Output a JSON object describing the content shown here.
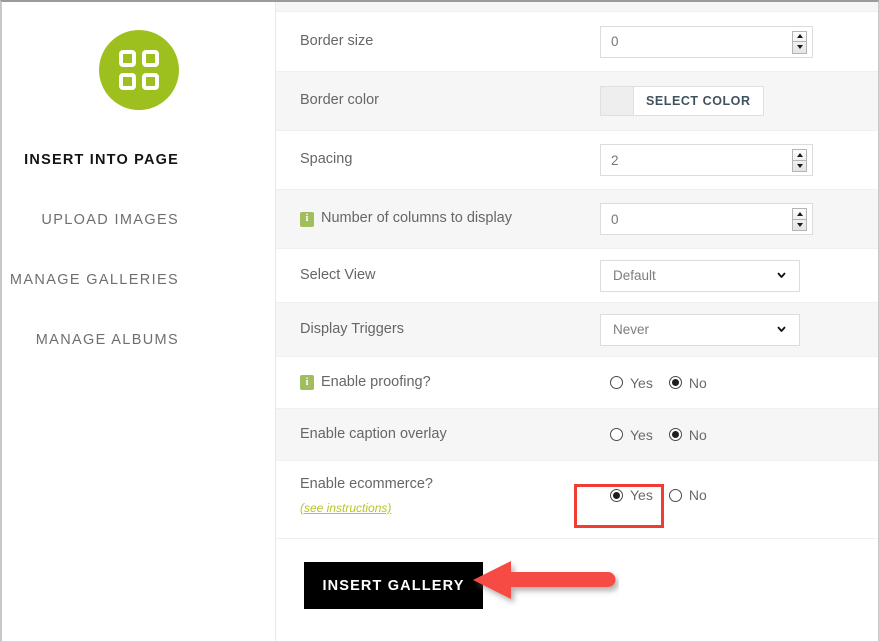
{
  "sidebar": {
    "logo_icon": "grid-squares-icon",
    "logo_color": "#9dc01f",
    "items": [
      {
        "label": "INSERT INTO PAGE",
        "active": true
      },
      {
        "label": "UPLOAD IMAGES",
        "active": false
      },
      {
        "label": "MANAGE GALLERIES",
        "active": false
      },
      {
        "label": "MANAGE ALBUMS",
        "active": false
      }
    ]
  },
  "form": {
    "rows": [
      {
        "label": "Border size",
        "type": "number",
        "value": "0",
        "info": false
      },
      {
        "label": "Border color",
        "type": "color",
        "value": "SELECT COLOR",
        "info": false
      },
      {
        "label": "Spacing",
        "type": "number",
        "value": "2",
        "info": false
      },
      {
        "label": "Number of columns to display",
        "type": "number",
        "value": "0",
        "info": true
      },
      {
        "label": "Select View",
        "type": "select",
        "value": "Default",
        "info": false
      },
      {
        "label": "Display Triggers",
        "type": "select",
        "value": "Never",
        "info": false
      },
      {
        "label": "Enable proofing?",
        "type": "radio",
        "value": "No",
        "info": true
      },
      {
        "label": "Enable caption overlay",
        "type": "radio",
        "value": "No",
        "info": false
      },
      {
        "label": "Enable ecommerce?",
        "type": "radio",
        "value": "Yes",
        "info": false,
        "sublink": "(see instructions)"
      }
    ],
    "radio_options": {
      "yes": "Yes",
      "no": "No"
    },
    "submit_label": "INSERT GALLERY"
  },
  "annotations": {
    "highlight_color": "#ef3c35",
    "arrow_color": "#f64b45",
    "arrow_direction": "left",
    "highlight_target": "Enable ecommerce? Yes radio",
    "arrow_target": "INSERT GALLERY button"
  }
}
